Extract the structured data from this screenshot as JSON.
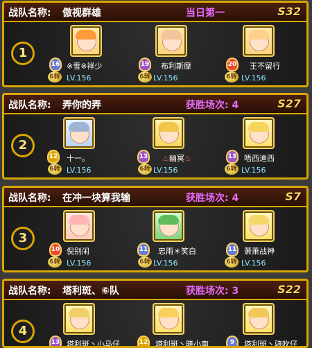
{
  "header_label": "战队名称:",
  "teams": [
    {
      "name": "傲视群雄",
      "stat": "当日第一",
      "server": "S32",
      "rank": "1",
      "players": [
        {
          "name": "※雪※祥少",
          "badge": "16",
          "coin": "6转",
          "level": "LV.156",
          "badge_color": "#6a7bd6",
          "hair": "#ff9a3a"
        },
        {
          "name": "布利斯摩",
          "badge": "19",
          "coin": "6转",
          "level": "LV.156",
          "badge_color": "#9a54c8",
          "hair": "#f3c59a"
        },
        {
          "name": "王不留行",
          "badge": "20",
          "coin": "6转",
          "level": "LV.156",
          "badge_color": "#e84a2e",
          "hair": "#ffd08a"
        }
      ]
    },
    {
      "name": "弄你的弄",
      "stat": "获胜场次: 4",
      "server": "S27",
      "rank": "2",
      "players": [
        {
          "name": "十一。",
          "badge": "12",
          "coin": "6转",
          "level": "LV.156",
          "badge_color": "#d9a600",
          "hair": "#9fb4d4"
        },
        {
          "name": "幽冥",
          "badge": "13",
          "coin": "6转",
          "level": "LV.156",
          "badge_color": "#9a54c8",
          "hair": "#f2c54b"
        },
        {
          "name": "唔西迪西",
          "badge": "13",
          "coin": "6转",
          "level": "LV.156",
          "badge_color": "#9a54c8",
          "hair": "#f6d45e"
        }
      ]
    },
    {
      "name": "在冲一块算我输",
      "stat": "获胜场次: 4",
      "server": "S7",
      "rank": "3",
      "players": [
        {
          "name": "倪别闹",
          "badge": "10",
          "coin": "6转",
          "level": "LV.156",
          "badge_color": "#e84a2e",
          "hair": "#ffb5b5"
        },
        {
          "name": "忠雨＊笑白",
          "badge": "11",
          "coin": "6转",
          "level": "LV.156",
          "badge_color": "#6a7bd6",
          "hair": "#5ebd5a"
        },
        {
          "name": "萧萧战神",
          "badge": "11",
          "coin": "6转",
          "level": "LV.156",
          "badge_color": "#6a7bd6",
          "hair": "#f5d86a"
        }
      ]
    },
    {
      "name": "塔利斑、⑥队",
      "stat": "获胜场次: 3",
      "server": "S22",
      "rank": "4",
      "players": [
        {
          "name": "塔利斑丶小马仔",
          "badge": "13",
          "coin": "",
          "level": "",
          "badge_color": "#9a54c8",
          "hair": "#f0d06a"
        },
        {
          "name": "塔利斑丶晓小南",
          "badge": "12",
          "coin": "",
          "level": "",
          "badge_color": "#d9a600",
          "hair": "#f7d15a"
        },
        {
          "name": "塔利斑丶骁吹仔",
          "badge": "9",
          "coin": "",
          "level": "",
          "badge_color": "#6a7bd6",
          "hair": "#f1c85a"
        }
      ]
    }
  ]
}
